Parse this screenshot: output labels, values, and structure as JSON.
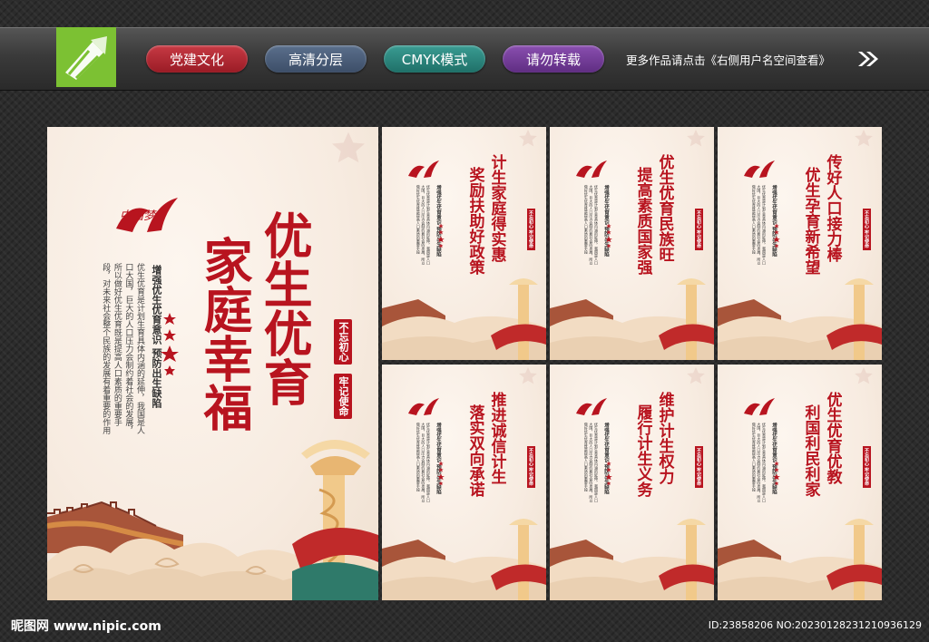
{
  "header": {
    "tags": [
      "党建文化",
      "高清分层",
      "CMYK模式",
      "请勿转载"
    ],
    "more_text": "更多作品请点击《右侧用户名空间查看》"
  },
  "main_panel": {
    "title_col1": "优生优育",
    "title_col2": "家庭幸福",
    "subtitle": "增强优生优育意识  预防出生缺陷",
    "body": "优生优育是计划生育具体内涵的延伸，我国是人口大国，巨大的人口压力会制约着社会的发展，所以做好优生优育既是提高人口素质的重要手段，对未来社会整个民族的发展有着重要的作用",
    "seal1": "不忘初心",
    "seal2": "牢记使命",
    "brand": "中国梦"
  },
  "small_panels": [
    {
      "title_col1": "计生家庭得实惠",
      "title_col2": "奖励扶助好政策"
    },
    {
      "title_col1": "优生优育民族旺",
      "title_col2": "提高素质国家强"
    },
    {
      "title_col1": "传好人口接力棒",
      "title_col2": "优生孕育新希望"
    },
    {
      "title_col1": "推进诚信计生",
      "title_col2": "落实双向承诺"
    },
    {
      "title_col1": "维护计生权力",
      "title_col2": "履行计生义务"
    },
    {
      "title_col1": "优生优育优教",
      "title_col2": "利国利民利家"
    }
  ],
  "small_common": {
    "subtitle": "增强优生优育意识  预防出生缺陷",
    "seal": "不忘初心 牢记使命",
    "body": "优生优育是计划生育具体内涵的延伸，我国是人口大国，巨大的人口压力会制约着社会的发展，所以做好优生优育既是提高人口素质的重要手段"
  },
  "footer": {
    "site": "昵图网 www.nipic.com",
    "id_text": "ID:23858206 NO:20230128231210936129"
  },
  "colors": {
    "accent_red": "#b8141f",
    "logo_green": "#7cc133",
    "panel_bg": "#f7ebe0"
  }
}
